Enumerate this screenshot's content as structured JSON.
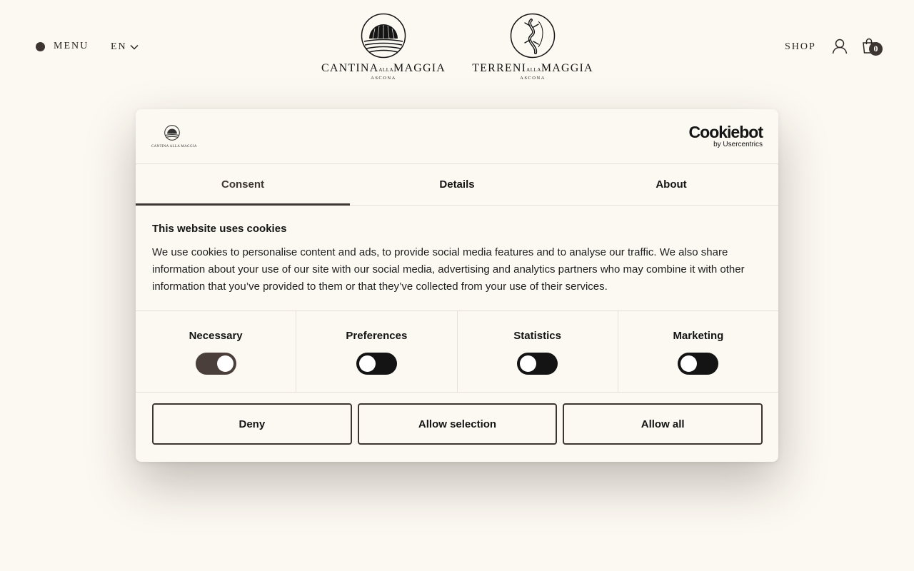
{
  "header": {
    "menu_label": "MENU",
    "lang_label": "EN",
    "brand_left": {
      "main1": "CANTINA",
      "small": "ALLA",
      "main2": "MAGGIA",
      "sub": "ASCONA"
    },
    "brand_right": {
      "main1": "TERRENI",
      "small": "ALLA",
      "main2": "MAGGIA",
      "sub": "ASCONA"
    },
    "shop_label": "SHOP",
    "cart_count": "0"
  },
  "dialog": {
    "logo_text": "CANTINA ALLA MAGGIA",
    "cookiebot_main": "Cookiebot",
    "cookiebot_sub": "by Usercentrics",
    "tabs": [
      {
        "label": "Consent"
      },
      {
        "label": "Details"
      },
      {
        "label": "About"
      }
    ],
    "title": "This website uses cookies",
    "description": "We use cookies to personalise content and ads, to provide social media features and to analyse our traffic. We also share information about your use of our site with our social media, advertising and analytics partners who may combine it with other information that you’ve provided to them or that they’ve collected from your use of their services.",
    "categories": [
      {
        "label": "Necessary",
        "enabled": true
      },
      {
        "label": "Preferences",
        "enabled": false
      },
      {
        "label": "Statistics",
        "enabled": false
      },
      {
        "label": "Marketing",
        "enabled": false
      }
    ],
    "buttons": {
      "deny": "Deny",
      "allow_selection": "Allow selection",
      "allow_all": "Allow all"
    }
  },
  "colors": {
    "background": "#fcf9f2",
    "accent": "#3d3532",
    "text": "#141414"
  }
}
